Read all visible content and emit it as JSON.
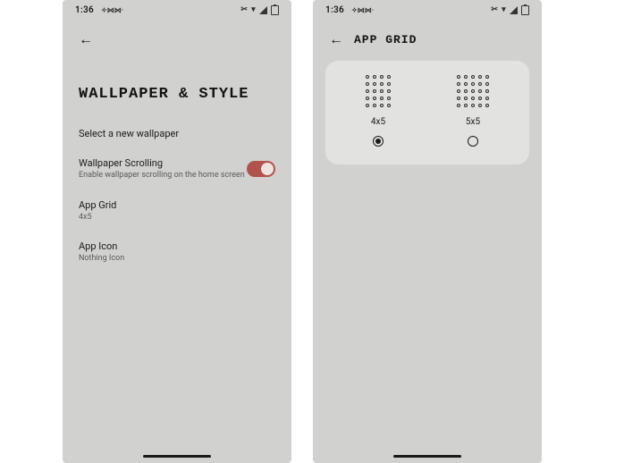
{
  "status": {
    "time": "1:36",
    "left_icons": "✧ ⋈ ⋈ ·",
    "right_icons": {
      "a": "✂",
      "b": "▾"
    }
  },
  "left": {
    "title": "WALLPAPER & STYLE",
    "select_wallpaper": "Select a new wallpaper",
    "wallpaper_scrolling": {
      "title": "Wallpaper Scrolling",
      "subtitle": "Enable wallpaper scrolling on the home screen",
      "enabled": true
    },
    "app_grid": {
      "title": "App Grid",
      "value": "4x5"
    },
    "app_icon": {
      "title": "App Icon",
      "value": "Nothing Icon"
    }
  },
  "right": {
    "title": "APP GRID",
    "options": [
      {
        "label": "4x5",
        "cols": 4,
        "rows": 5,
        "selected": true
      },
      {
        "label": "5x5",
        "cols": 5,
        "rows": 5,
        "selected": false
      }
    ]
  }
}
